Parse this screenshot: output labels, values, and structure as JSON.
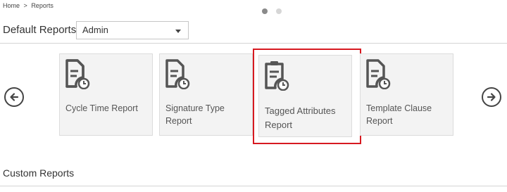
{
  "breadcrumb": {
    "home": "Home",
    "separator": ">",
    "current": "Reports"
  },
  "pager": {
    "active_index": 0,
    "count": 2,
    "active_color": "#8a8a8a",
    "inactive_color": "#d6d6d6"
  },
  "default_reports": {
    "title": "Default Reports",
    "filter_value": "Admin",
    "cards": [
      {
        "label": "Cycle Time Report",
        "icon": "document-clock-icon"
      },
      {
        "label": "Signature Type Report",
        "icon": "document-clock-icon"
      },
      {
        "label": "Tagged Attributes Report",
        "icon": "clipboard-clock-icon",
        "highlighted": true
      },
      {
        "label": "Template Clause Report",
        "icon": "document-clock-icon"
      }
    ]
  },
  "carousel": {
    "prev_icon": "arrow-left-circle-icon",
    "next_icon": "arrow-right-circle-icon"
  },
  "custom_reports": {
    "title": "Custom Reports"
  },
  "colors": {
    "highlight": "#d71920",
    "card_bg": "#f3f3f3",
    "icon": "#555555"
  }
}
